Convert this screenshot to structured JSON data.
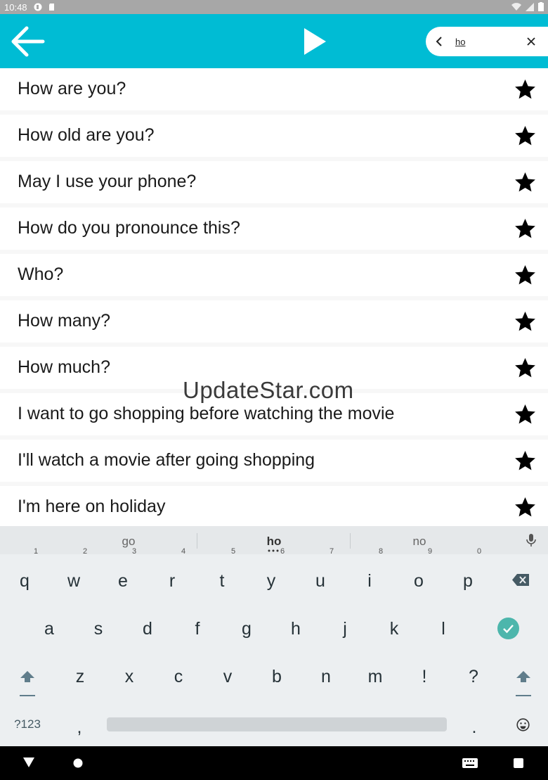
{
  "status_bar": {
    "time": "10:48"
  },
  "app_bar": {
    "back_icon": "arrow-back-icon",
    "play_icon": "play-icon",
    "search": {
      "value": "ho",
      "placeholder": ""
    }
  },
  "phrases": [
    {
      "text": "How are you?"
    },
    {
      "text": "How old are you?"
    },
    {
      "text": "May I use your phone?"
    },
    {
      "text": "How do you pronounce this?"
    },
    {
      "text": "Who?"
    },
    {
      "text": "How many?"
    },
    {
      "text": "How much?"
    },
    {
      "text": "I want to go shopping before watching the movie"
    },
    {
      "text": "I'll watch a movie after going shopping"
    },
    {
      "text": "I'm here on holiday"
    }
  ],
  "watermark": "UpdateStar.com",
  "keyboard": {
    "suggestions": [
      "go",
      "ho",
      "no"
    ],
    "row1": [
      {
        "k": "q",
        "h": "1"
      },
      {
        "k": "w",
        "h": "2"
      },
      {
        "k": "e",
        "h": "3"
      },
      {
        "k": "r",
        "h": "4"
      },
      {
        "k": "t",
        "h": "5"
      },
      {
        "k": "y",
        "h": "6"
      },
      {
        "k": "u",
        "h": "7"
      },
      {
        "k": "i",
        "h": "8"
      },
      {
        "k": "o",
        "h": "9"
      },
      {
        "k": "p",
        "h": "0"
      }
    ],
    "row2": [
      "a",
      "s",
      "d",
      "f",
      "g",
      "h",
      "j",
      "k",
      "l"
    ],
    "row3": [
      "z",
      "x",
      "c",
      "v",
      "b",
      "n",
      "m",
      "!",
      "?"
    ],
    "symbols_label": "?123",
    "comma": ",",
    "period": ".",
    "accent_color": "#4db6ac"
  },
  "colors": {
    "app_bar": "#00bcd4",
    "status_bar": "#a7a7a7"
  }
}
